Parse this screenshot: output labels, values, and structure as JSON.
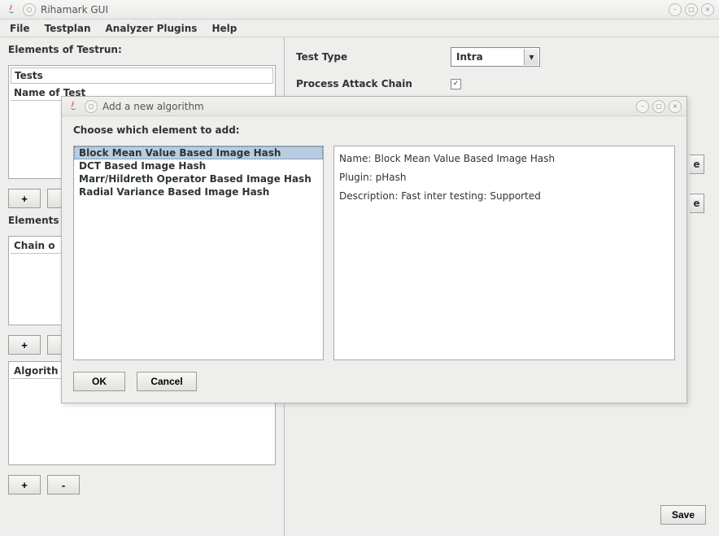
{
  "main": {
    "title": "Rihamark GUI",
    "menu": {
      "file": "File",
      "testplan": "Testplan",
      "analyzer": "Analyzer Plugins",
      "help": "Help"
    }
  },
  "left": {
    "elements_label": "Elements of Testrun:",
    "tests_header": "Tests",
    "tests_col": "Name of Test",
    "elements2_label": "Elements",
    "chain_header": "Chain o",
    "algo_header": "Algorith",
    "plus": "+",
    "minus": "-"
  },
  "right": {
    "test_type_label": "Test Type",
    "test_type_value": "Intra",
    "process_label": "Process Attack Chain",
    "browse_e": "e",
    "save": "Save"
  },
  "dialog": {
    "title": "Add a new algorithm",
    "prompt": "Choose which element to add:",
    "items": [
      "Block Mean Value Based Image Hash",
      "DCT Based Image Hash",
      "Marr/Hildreth Operator Based Image Hash",
      "Radial Variance Based Image Hash"
    ],
    "detail": {
      "name_label": "Name:",
      "name_value": "Block Mean Value Based Image Hash",
      "plugin_label": "Plugin:",
      "plugin_value": "pHash",
      "desc_label": "Description:",
      "desc_value": "Fast inter testing: Supported"
    },
    "ok": "OK",
    "cancel": "Cancel"
  }
}
